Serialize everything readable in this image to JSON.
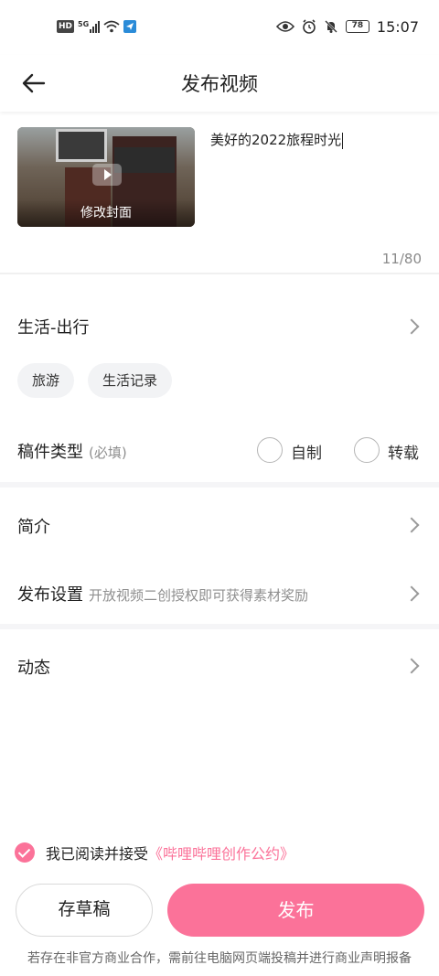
{
  "status_bar": {
    "hd_badge": "HD",
    "network": "5G",
    "battery": "78",
    "time": "15:07"
  },
  "header": {
    "title": "发布视频"
  },
  "video": {
    "cover_label": "修改封面",
    "title_value": "美好的2022旅程时光",
    "char_counter": "11/80"
  },
  "category": {
    "label": "生活-出行",
    "tags": [
      "旅游",
      "生活记录"
    ]
  },
  "manuscript_type": {
    "label": "稿件类型",
    "required_hint": "(必填)",
    "options": [
      "自制",
      "转载"
    ]
  },
  "intro": {
    "label": "简介"
  },
  "publish_settings": {
    "label": "发布设置",
    "hint": "开放视频二创授权即可获得素材奖励"
  },
  "dynamic": {
    "label": "动态"
  },
  "agreement": {
    "text": "我已阅读并接受",
    "link": "《哔哩哔哩创作公约》"
  },
  "actions": {
    "draft_label": "存草稿",
    "publish_label": "发布"
  },
  "footer_notice": "若存在非官方商业合作，需前往电脑网页端投稿并进行商业声明报备",
  "colors": {
    "accent": "#fb7299"
  }
}
